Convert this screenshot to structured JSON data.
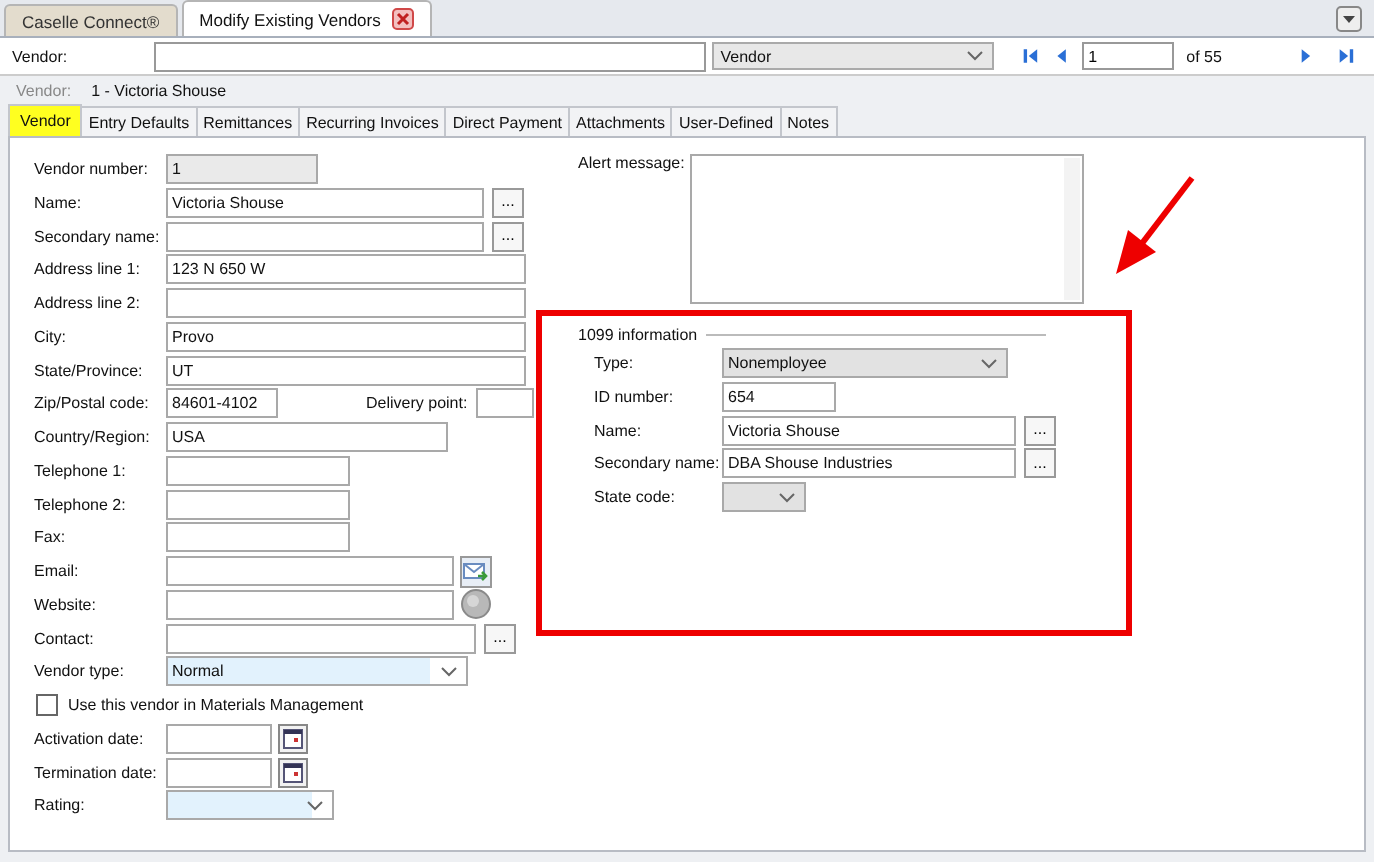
{
  "document_tabs": [
    {
      "label": "Caselle Connect®",
      "selected": false,
      "closable": false
    },
    {
      "label": "Modify Existing Vendors",
      "selected": true,
      "closable": true
    }
  ],
  "toolbar": {
    "vendor_label": "Vendor:",
    "lookup_by": "Vendor",
    "record": "1",
    "record_count": "of 55"
  },
  "vendor_line": {
    "label": "Vendor:",
    "value": "1  - Victoria Shouse"
  },
  "tabs": [
    {
      "label": "Vendor",
      "selected": true
    },
    {
      "label": "Entry Defaults",
      "selected": false
    },
    {
      "label": "Remittances",
      "selected": false
    },
    {
      "label": "Recurring Invoices",
      "selected": false
    },
    {
      "label": "Direct Payment",
      "selected": false
    },
    {
      "label": "Attachments",
      "selected": false
    },
    {
      "label": "User-Defined",
      "selected": false
    },
    {
      "label": "Notes",
      "selected": false
    }
  ],
  "fields": [
    {
      "kind": "readonly",
      "label": "Vendor number:",
      "value": "1"
    },
    {
      "kind": "lookup",
      "label": "Name:",
      "value": "Victoria Shouse",
      "button": "..."
    },
    {
      "kind": "lookup",
      "label": "Secondary name:",
      "button": "..."
    },
    {
      "kind": "text",
      "label": "Address line 1:",
      "value": "123 N 650 W"
    },
    {
      "kind": "text",
      "label": "Address line 2:"
    },
    {
      "kind": "text",
      "label": "City:",
      "value": "Provo"
    },
    {
      "kind": "text",
      "label": "State/Province:",
      "value": "UT"
    },
    {
      "kind": "zip",
      "label": "Zip/Postal code:",
      "value": "84601-4102",
      "extra_label": "Delivery point:"
    },
    {
      "kind": "text",
      "label": "Country/Region:",
      "value": "USA"
    },
    {
      "kind": "text",
      "label": "Telephone 1:"
    },
    {
      "kind": "text",
      "label": "Telephone 2:"
    },
    {
      "kind": "text",
      "label": "Fax:"
    },
    {
      "kind": "email",
      "label": "Email:"
    },
    {
      "kind": "website",
      "label": "Website:"
    },
    {
      "kind": "lookup",
      "label": "Contact:",
      "button": "..."
    },
    {
      "kind": "select",
      "label": "Vendor type:",
      "value": "Normal"
    },
    {
      "kind": "checkbox",
      "label": "Use this vendor in Materials Management",
      "checked": false
    },
    {
      "kind": "date",
      "label": "Activation date:"
    },
    {
      "kind": "date",
      "label": "Termination date:"
    },
    {
      "kind": "select",
      "label": "Rating:"
    }
  ],
  "alert": {
    "label": "Alert message:"
  },
  "info_1099": {
    "title": "1099 information",
    "fields": [
      {
        "kind": "select",
        "label": "Type:",
        "value": "Nonemployee"
      },
      {
        "kind": "text",
        "label": "ID number:",
        "value": "654"
      },
      {
        "kind": "lookup",
        "label": "Name:",
        "value": "Victoria Shouse",
        "button": "..."
      },
      {
        "kind": "lookup",
        "label": "Secondary name:",
        "value": "DBA Shouse Industries",
        "button": "..."
      },
      {
        "kind": "select",
        "label": "State code:"
      }
    ]
  }
}
